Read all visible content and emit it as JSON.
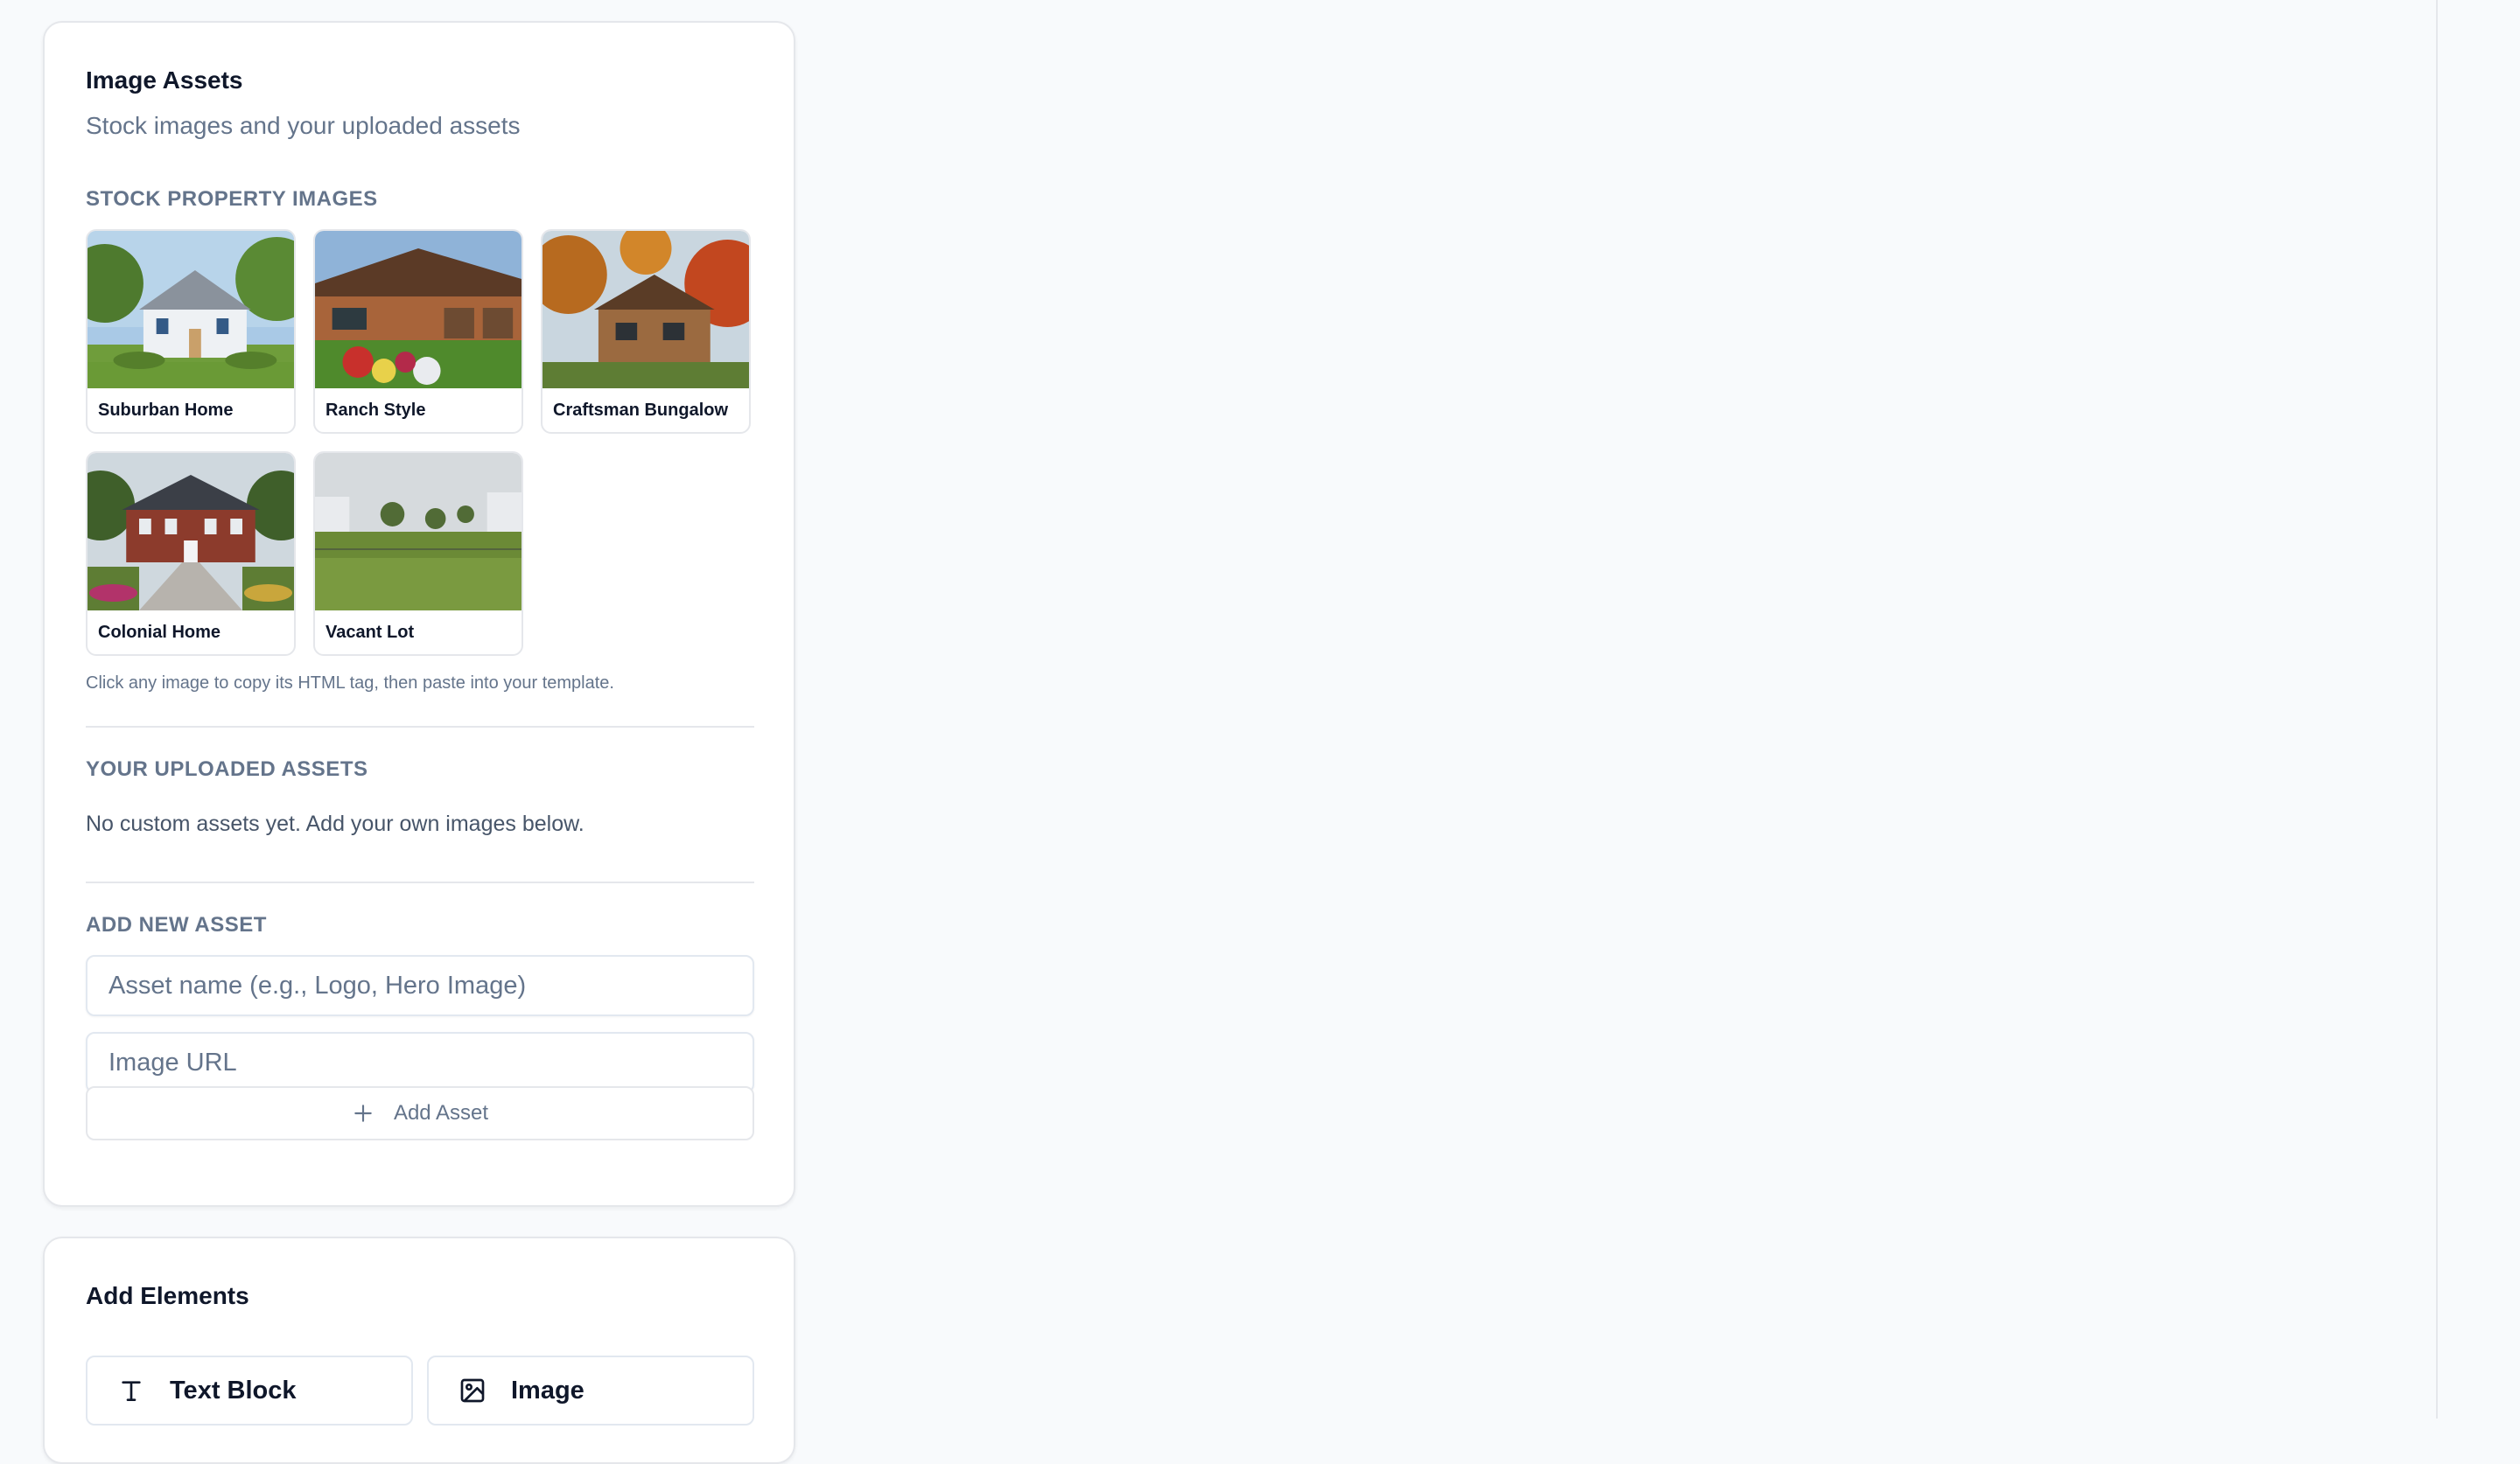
{
  "image_assets": {
    "title": "Image Assets",
    "subtitle": "Stock images and your uploaded assets",
    "stock_section_label": "STOCK PROPERTY IMAGES",
    "stock_images": [
      {
        "label": "Suburban Home"
      },
      {
        "label": "Ranch Style"
      },
      {
        "label": "Craftsman Bungalow"
      },
      {
        "label": "Colonial Home"
      },
      {
        "label": "Vacant Lot"
      }
    ],
    "hint": "Click any image to copy its HTML tag, then paste into your template.",
    "uploaded_section_label": "YOUR UPLOADED ASSETS",
    "uploaded_empty": "No custom assets yet. Add your own images below.",
    "add_section_label": "ADD NEW ASSET",
    "name_placeholder": "Asset name (e.g., Logo, Hero Image)",
    "url_placeholder": "Image URL",
    "add_button_label": "Add Asset"
  },
  "add_elements": {
    "title": "Add Elements",
    "buttons": [
      {
        "label": "Text Block",
        "icon": "text-icon"
      },
      {
        "label": "Image",
        "icon": "image-icon"
      }
    ]
  }
}
